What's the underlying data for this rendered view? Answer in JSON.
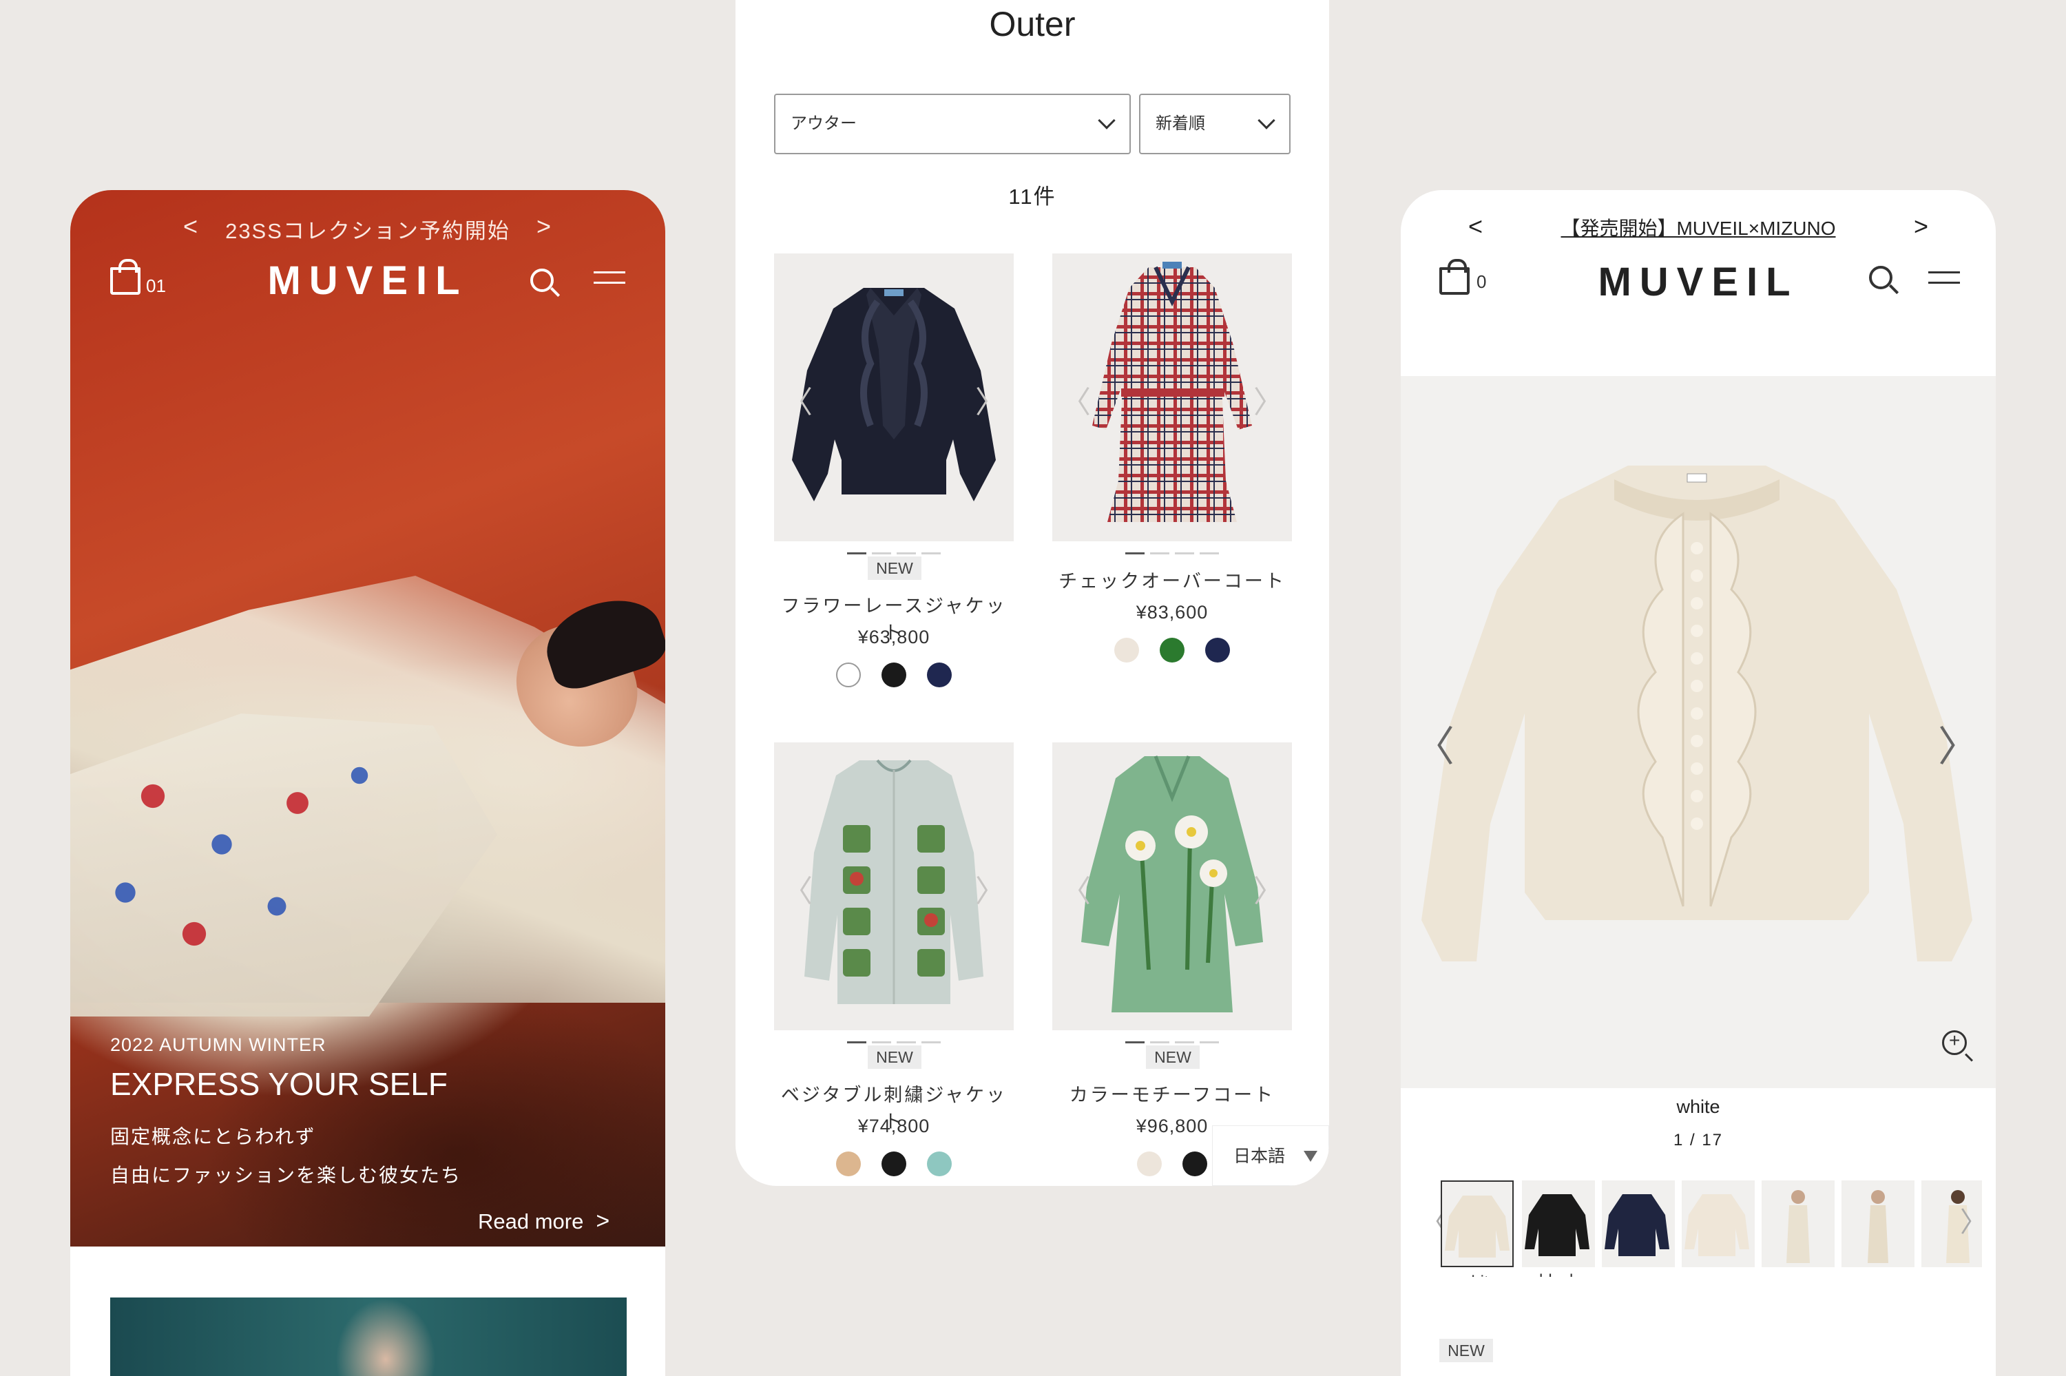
{
  "left": {
    "promo_text": "23SSコレクション予約開始",
    "prev": "<",
    "next": ">",
    "logo": "MUVEIL",
    "cart_count": "01",
    "season": "2022 AUTUMN WINTER",
    "headline": "EXPRESS YOUR SELF",
    "copy_line1": "固定概念にとらわれず",
    "copy_line2": "自由にファッションを楽しむ彼女たち",
    "read_more": "Read more",
    "chevron": ">"
  },
  "center": {
    "title": "Outer",
    "category_select": "アウター",
    "sort_select": "新着順",
    "count": "11件",
    "nav_prev": "〈",
    "nav_next": "〉",
    "products": [
      {
        "name": "フラワーレースジャケット",
        "price": "¥63,800",
        "badge": "NEW",
        "swatches": [
          "#ffffff",
          "#1a1a1a",
          "#1f2750"
        ]
      },
      {
        "name": "チェックオーバーコート",
        "price": "¥83,600",
        "badge": "",
        "swatches": [
          "#ede5db",
          "#2b7a2e",
          "#1f2750"
        ]
      },
      {
        "name": "ベジタブル刺繍ジャケット",
        "price": "¥74,800",
        "badge": "NEW",
        "swatches": [
          "#dcb68f",
          "#1a1a1a",
          "#8ec7c0"
        ]
      },
      {
        "name": "カラーモチーフコート",
        "price": "¥96,800",
        "badge": "NEW",
        "swatches": [
          "#ede5db",
          "#1a1a1a"
        ]
      }
    ],
    "language": "日本語"
  },
  "right": {
    "promo_text": "【発売開始】MUVEIL×MIZUNO",
    "prev": "<",
    "next": ">",
    "logo": "MUVEIL",
    "cart_count": "0",
    "hero_prev": "〈",
    "hero_next": "〉",
    "color_name": "white",
    "pager": "1 / 17",
    "thumb_labels": [
      "white",
      "black",
      "navy"
    ],
    "new_badge": "NEW"
  },
  "colors": {
    "background": "#ece9e6",
    "hero_red": "#b4321b",
    "text_dark": "#222222"
  }
}
